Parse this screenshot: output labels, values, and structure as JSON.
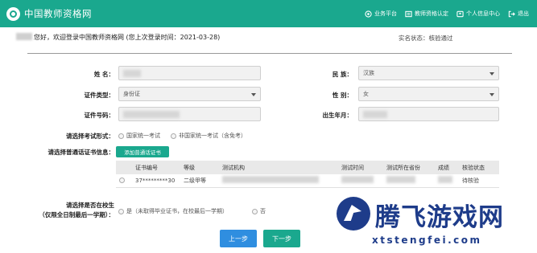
{
  "header": {
    "site_title": "中国教师资格网",
    "nav": [
      {
        "label": "业务平台",
        "icon": "platform-icon"
      },
      {
        "label": "教师资格认定",
        "icon": "certificate-icon"
      },
      {
        "label": "个人信息中心",
        "icon": "user-icon"
      },
      {
        "label": "退出",
        "icon": "logout-icon"
      }
    ]
  },
  "welcome": {
    "text": "您好，欢迎登录中国教师资格网 (您上次登录时间：2021-03-28)",
    "status": "实名状态：核验通过"
  },
  "form": {
    "name_label": "姓  名：",
    "ethnicity_label": "民  族：",
    "ethnicity_value": "汉族",
    "id_type_label": "证件类型：",
    "id_type_value": "身份证",
    "gender_label": "性  别：",
    "gender_value": "女",
    "id_number_label": "证件号码：",
    "birth_label": "出生年月：",
    "exam_form_label": "请选择考试形式：",
    "exam_options": [
      "国家统一考试",
      "非国家统一考试（含免考）"
    ],
    "mandarin_label": "请选择普通话证书信息：",
    "add_mandarin_btn": "添加普通话证书",
    "student_label_1": "请选择是否在校生",
    "student_label_2": "（仅限全日制最后一学期）：",
    "student_yes": "是（未取得毕业证书，在校最后一学期）",
    "student_no": "否"
  },
  "table": {
    "headers": [
      "证书编号",
      "等级",
      "测试机构",
      "测试时间",
      "测试所在省份",
      "成绩",
      "核验状态"
    ],
    "rows": [
      {
        "cert_no": "37*********30",
        "level": "二级甲等",
        "status": "待核验"
      }
    ]
  },
  "buttons": {
    "prev": "上一步",
    "next": "下一步"
  },
  "watermark": {
    "text": "腾飞游戏网",
    "url": "xtstengfei.com"
  },
  "colors": {
    "header": "#1aa88e",
    "prev_button": "#2f8ee0",
    "next_button": "#1aa88e",
    "watermark": "#1e3c8a"
  }
}
